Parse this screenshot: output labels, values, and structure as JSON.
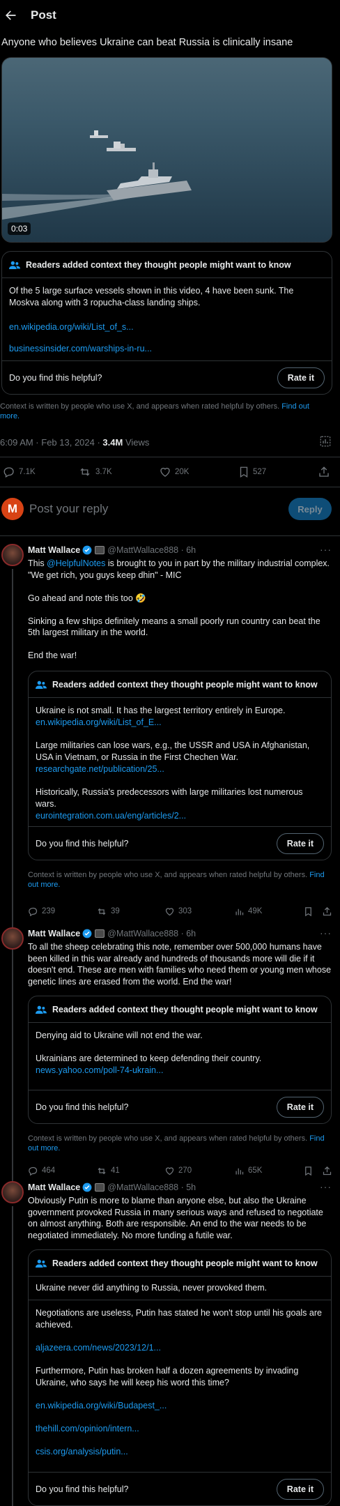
{
  "header": {
    "title": "Post"
  },
  "post": {
    "text": "Anyone who believes Ukraine can beat Russia is clinically insane",
    "video_duration": "0:03",
    "note": {
      "heading": "Readers added context they thought people might want to know",
      "body": "Of the 5 large surface vessels shown in this video, 4 have been sunk. The Moskva along with 3 ropucha-class landing ships.",
      "links": [
        "en.wikipedia.org/wiki/List_of_s...",
        "businessinsider.com/warships-in-ru..."
      ],
      "helpful_q": "Do you find this helpful?",
      "rate_label": "Rate it"
    },
    "disclaimer": "Context is written by people who use X, and appears when rated helpful by others.",
    "find_out_more": "Find out more.",
    "timestamp": "6:09 AM · Feb 13, 2024 · ",
    "views_count": "3.4M",
    "views_label": " Views",
    "stats": {
      "replies": "7.1K",
      "reposts": "3.7K",
      "likes": "20K",
      "bookmarks": "527"
    }
  },
  "compose": {
    "avatar_letter": "M",
    "placeholder": "Post your reply",
    "button": "Reply"
  },
  "replies": [
    {
      "name": "Matt Wallace",
      "handle": "@MattWallace888 · 6h",
      "paragraphs": [
        "This @HelpfulNotes is brought to you in part by the military industrial complex. \"We get rich, you guys keep dhin\" - MIC",
        "Go ahead and note this too 🤣",
        "Sinking a few ships definitely means a small poorly run country can beat the 5th largest military in the world.",
        "End the war!"
      ],
      "mention": "@HelpfulNotes",
      "note": {
        "heading": "Readers added context they thought people might want to know",
        "items": [
          {
            "text": "Ukraine is not small. It has the largest territory entirely in Europe.",
            "link": "en.wikipedia.org/wiki/List_of_E..."
          },
          {
            "text": "Large militaries can lose wars, e.g., the USSR and USA in Afghanistan, USA in Vietnam, or Russia in the First Chechen War.",
            "link": "researchgate.net/publication/25..."
          },
          {
            "text": "Historically, Russia's predecessors with large militaries lost numerous wars.",
            "link": "eurointegration.com.ua/eng/articles/2..."
          }
        ],
        "helpful_q": "Do you find this helpful?",
        "rate_label": "Rate it"
      },
      "disclaimer": "Context is written by people who use X, and appears when rated helpful by others.",
      "find_out_more": "Find out more.",
      "stats": {
        "replies": "239",
        "reposts": "39",
        "likes": "303",
        "views": "49K"
      }
    },
    {
      "name": "Matt Wallace",
      "handle": "@MattWallace888 · 6h",
      "paragraphs": [
        "To all the sheep celebrating this note, remember over 500,000 humans have been killed in this war already and hundreds of thousands more will die if it doesn't end. These are men with families who need them or young men whose genetic lines are erased from the world. End the war!"
      ],
      "note": {
        "heading": "Readers added context they thought people might want to know",
        "items": [
          {
            "text": "Denying aid to Ukraine will not end the war.",
            "link": ""
          },
          {
            "text": "Ukrainians are determined to keep defending their country.",
            "link": "news.yahoo.com/poll-74-ukrain..."
          }
        ],
        "helpful_q": "Do you find this helpful?",
        "rate_label": "Rate it"
      },
      "disclaimer": "Context is written by people who use X, and appears when rated helpful by others.",
      "find_out_more": "Find out more.",
      "stats": {
        "replies": "464",
        "reposts": "41",
        "likes": "270",
        "views": "65K"
      }
    },
    {
      "name": "Matt Wallace",
      "handle": "@MattWallace888 · 5h",
      "paragraphs": [
        "Obviously Putin is more to blame than anyone else, but also the Ukraine government provoked Russia in many serious ways and refused to negotiate on almost anything. Both are responsible. An end to the war needs to be negotiated immediately. No more funding a futile war."
      ],
      "note": {
        "heading": "Readers added context they thought people might want to know",
        "texts": [
          "Ukraine never did anything to Russia, never provoked them.",
          "Negotiations are useless, Putin has stated he won't stop until his goals are achieved.",
          "Furthermore, Putin has broken half a dozen agreements by invading Ukraine, who says he will keep his word this time?"
        ],
        "links": [
          "aljazeera.com/news/2023/12/1...",
          "en.wikipedia.org/wiki/Budapest_...",
          "thehill.com/opinion/intern...",
          "csis.org/analysis/putin..."
        ],
        "helpful_q": "Do you find this helpful?",
        "rate_label": "Rate it"
      }
    }
  ],
  "colors": {
    "accent": "#1d9bf0",
    "muted": "#71767b",
    "border": "#2f3336"
  }
}
